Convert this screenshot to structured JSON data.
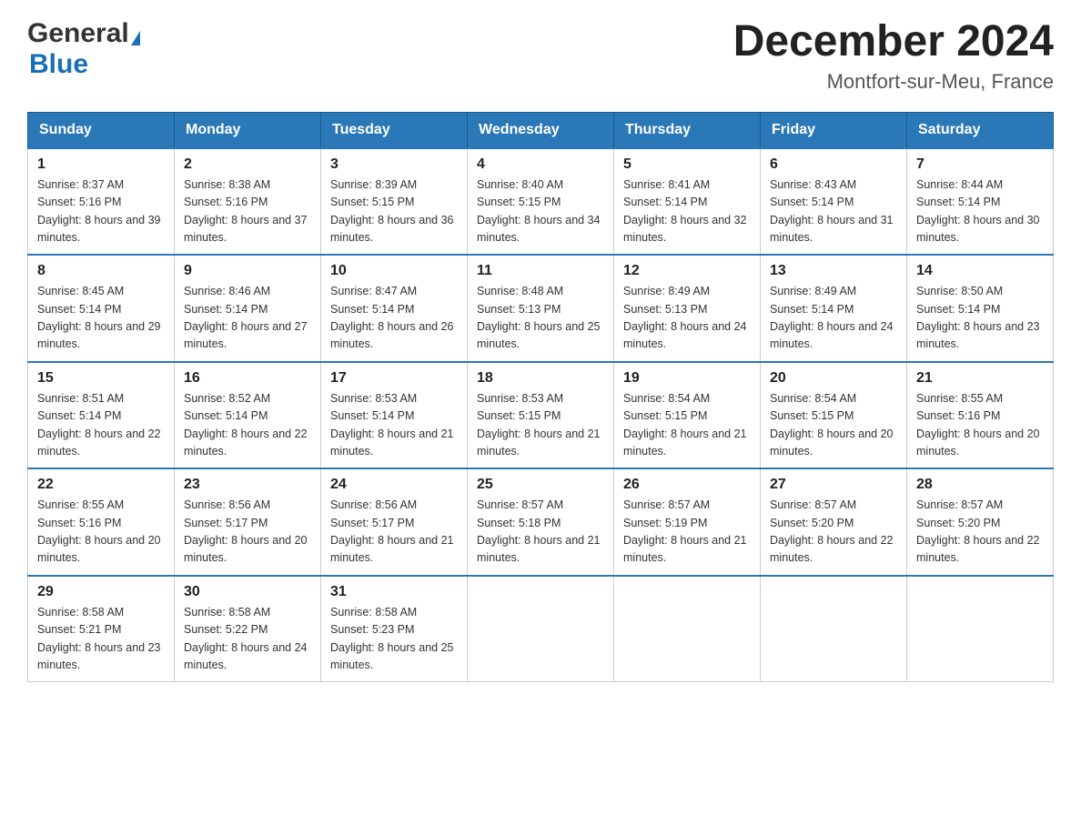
{
  "header": {
    "logo_general": "General",
    "logo_blue": "Blue",
    "month_title": "December 2024",
    "location": "Montfort-sur-Meu, France"
  },
  "weekdays": [
    "Sunday",
    "Monday",
    "Tuesday",
    "Wednesday",
    "Thursday",
    "Friday",
    "Saturday"
  ],
  "weeks": [
    [
      {
        "day": "1",
        "sunrise": "Sunrise: 8:37 AM",
        "sunset": "Sunset: 5:16 PM",
        "daylight": "Daylight: 8 hours and 39 minutes."
      },
      {
        "day": "2",
        "sunrise": "Sunrise: 8:38 AM",
        "sunset": "Sunset: 5:16 PM",
        "daylight": "Daylight: 8 hours and 37 minutes."
      },
      {
        "day": "3",
        "sunrise": "Sunrise: 8:39 AM",
        "sunset": "Sunset: 5:15 PM",
        "daylight": "Daylight: 8 hours and 36 minutes."
      },
      {
        "day": "4",
        "sunrise": "Sunrise: 8:40 AM",
        "sunset": "Sunset: 5:15 PM",
        "daylight": "Daylight: 8 hours and 34 minutes."
      },
      {
        "day": "5",
        "sunrise": "Sunrise: 8:41 AM",
        "sunset": "Sunset: 5:14 PM",
        "daylight": "Daylight: 8 hours and 32 minutes."
      },
      {
        "day": "6",
        "sunrise": "Sunrise: 8:43 AM",
        "sunset": "Sunset: 5:14 PM",
        "daylight": "Daylight: 8 hours and 31 minutes."
      },
      {
        "day": "7",
        "sunrise": "Sunrise: 8:44 AM",
        "sunset": "Sunset: 5:14 PM",
        "daylight": "Daylight: 8 hours and 30 minutes."
      }
    ],
    [
      {
        "day": "8",
        "sunrise": "Sunrise: 8:45 AM",
        "sunset": "Sunset: 5:14 PM",
        "daylight": "Daylight: 8 hours and 29 minutes."
      },
      {
        "day": "9",
        "sunrise": "Sunrise: 8:46 AM",
        "sunset": "Sunset: 5:14 PM",
        "daylight": "Daylight: 8 hours and 27 minutes."
      },
      {
        "day": "10",
        "sunrise": "Sunrise: 8:47 AM",
        "sunset": "Sunset: 5:14 PM",
        "daylight": "Daylight: 8 hours and 26 minutes."
      },
      {
        "day": "11",
        "sunrise": "Sunrise: 8:48 AM",
        "sunset": "Sunset: 5:13 PM",
        "daylight": "Daylight: 8 hours and 25 minutes."
      },
      {
        "day": "12",
        "sunrise": "Sunrise: 8:49 AM",
        "sunset": "Sunset: 5:13 PM",
        "daylight": "Daylight: 8 hours and 24 minutes."
      },
      {
        "day": "13",
        "sunrise": "Sunrise: 8:49 AM",
        "sunset": "Sunset: 5:14 PM",
        "daylight": "Daylight: 8 hours and 24 minutes."
      },
      {
        "day": "14",
        "sunrise": "Sunrise: 8:50 AM",
        "sunset": "Sunset: 5:14 PM",
        "daylight": "Daylight: 8 hours and 23 minutes."
      }
    ],
    [
      {
        "day": "15",
        "sunrise": "Sunrise: 8:51 AM",
        "sunset": "Sunset: 5:14 PM",
        "daylight": "Daylight: 8 hours and 22 minutes."
      },
      {
        "day": "16",
        "sunrise": "Sunrise: 8:52 AM",
        "sunset": "Sunset: 5:14 PM",
        "daylight": "Daylight: 8 hours and 22 minutes."
      },
      {
        "day": "17",
        "sunrise": "Sunrise: 8:53 AM",
        "sunset": "Sunset: 5:14 PM",
        "daylight": "Daylight: 8 hours and 21 minutes."
      },
      {
        "day": "18",
        "sunrise": "Sunrise: 8:53 AM",
        "sunset": "Sunset: 5:15 PM",
        "daylight": "Daylight: 8 hours and 21 minutes."
      },
      {
        "day": "19",
        "sunrise": "Sunrise: 8:54 AM",
        "sunset": "Sunset: 5:15 PM",
        "daylight": "Daylight: 8 hours and 21 minutes."
      },
      {
        "day": "20",
        "sunrise": "Sunrise: 8:54 AM",
        "sunset": "Sunset: 5:15 PM",
        "daylight": "Daylight: 8 hours and 20 minutes."
      },
      {
        "day": "21",
        "sunrise": "Sunrise: 8:55 AM",
        "sunset": "Sunset: 5:16 PM",
        "daylight": "Daylight: 8 hours and 20 minutes."
      }
    ],
    [
      {
        "day": "22",
        "sunrise": "Sunrise: 8:55 AM",
        "sunset": "Sunset: 5:16 PM",
        "daylight": "Daylight: 8 hours and 20 minutes."
      },
      {
        "day": "23",
        "sunrise": "Sunrise: 8:56 AM",
        "sunset": "Sunset: 5:17 PM",
        "daylight": "Daylight: 8 hours and 20 minutes."
      },
      {
        "day": "24",
        "sunrise": "Sunrise: 8:56 AM",
        "sunset": "Sunset: 5:17 PM",
        "daylight": "Daylight: 8 hours and 21 minutes."
      },
      {
        "day": "25",
        "sunrise": "Sunrise: 8:57 AM",
        "sunset": "Sunset: 5:18 PM",
        "daylight": "Daylight: 8 hours and 21 minutes."
      },
      {
        "day": "26",
        "sunrise": "Sunrise: 8:57 AM",
        "sunset": "Sunset: 5:19 PM",
        "daylight": "Daylight: 8 hours and 21 minutes."
      },
      {
        "day": "27",
        "sunrise": "Sunrise: 8:57 AM",
        "sunset": "Sunset: 5:20 PM",
        "daylight": "Daylight: 8 hours and 22 minutes."
      },
      {
        "day": "28",
        "sunrise": "Sunrise: 8:57 AM",
        "sunset": "Sunset: 5:20 PM",
        "daylight": "Daylight: 8 hours and 22 minutes."
      }
    ],
    [
      {
        "day": "29",
        "sunrise": "Sunrise: 8:58 AM",
        "sunset": "Sunset: 5:21 PM",
        "daylight": "Daylight: 8 hours and 23 minutes."
      },
      {
        "day": "30",
        "sunrise": "Sunrise: 8:58 AM",
        "sunset": "Sunset: 5:22 PM",
        "daylight": "Daylight: 8 hours and 24 minutes."
      },
      {
        "day": "31",
        "sunrise": "Sunrise: 8:58 AM",
        "sunset": "Sunset: 5:23 PM",
        "daylight": "Daylight: 8 hours and 25 minutes."
      },
      null,
      null,
      null,
      null
    ]
  ]
}
